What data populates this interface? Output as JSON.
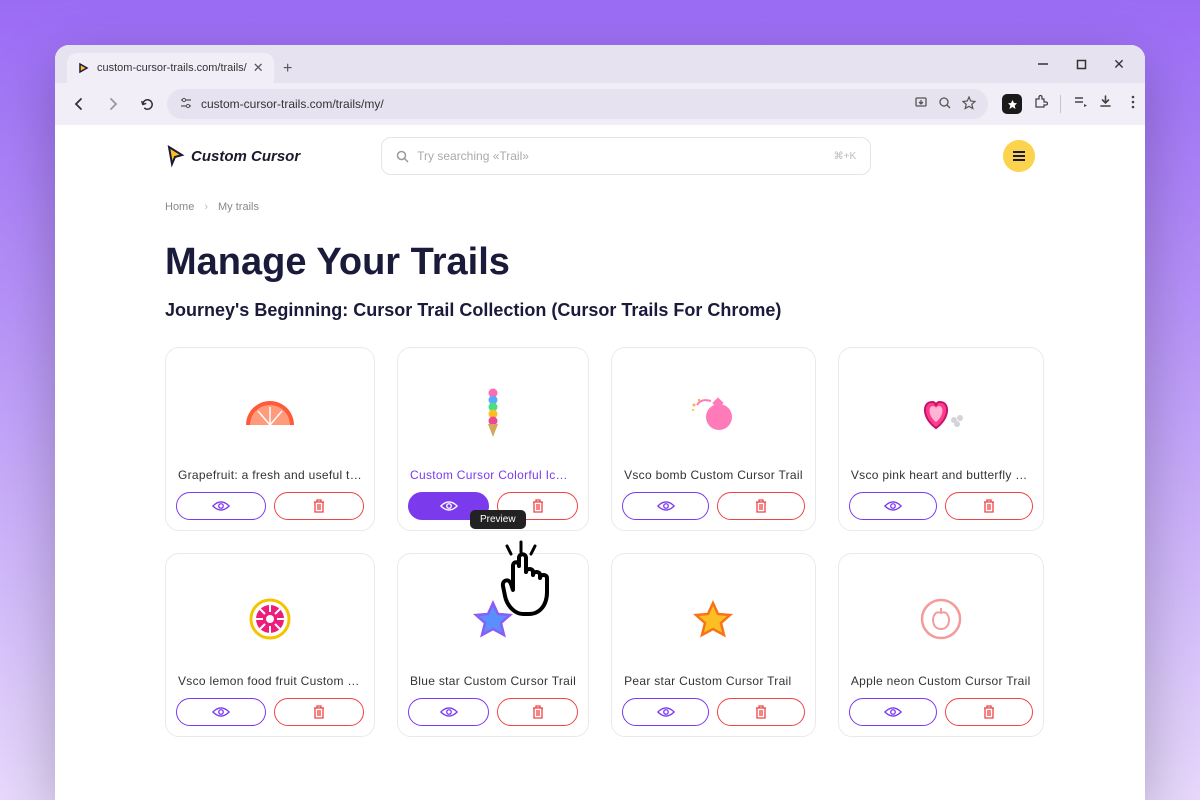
{
  "browser": {
    "tab_title": "custom-cursor-trails.com/trails/",
    "url": "custom-cursor-trails.com/trails/my/"
  },
  "site": {
    "logo_text": "Custom Cursor",
    "search_placeholder": "Try searching «Trail»",
    "search_shortcut": "⌘+K"
  },
  "breadcrumb": {
    "home": "Home",
    "current": "My trails"
  },
  "page": {
    "heading": "Manage Your Trails",
    "subheading": "Journey's Beginning: Cursor Trail Collection (Cursor Trails For Chrome)"
  },
  "tooltip": {
    "preview": "Preview"
  },
  "cards": [
    {
      "title": "Grapefruit: a fresh and useful t…"
    },
    {
      "title": "Custom Cursor Colorful Ic…"
    },
    {
      "title": "Vsco bomb Custom Cursor Trail"
    },
    {
      "title": "Vsco pink heart and butterfly …"
    },
    {
      "title": "Vsco lemon food fruit Custom …"
    },
    {
      "title": "Blue star Custom Cursor Trail"
    },
    {
      "title": "Pear star Custom Cursor Trail"
    },
    {
      "title": "Apple neon Custom Cursor Trail"
    }
  ]
}
